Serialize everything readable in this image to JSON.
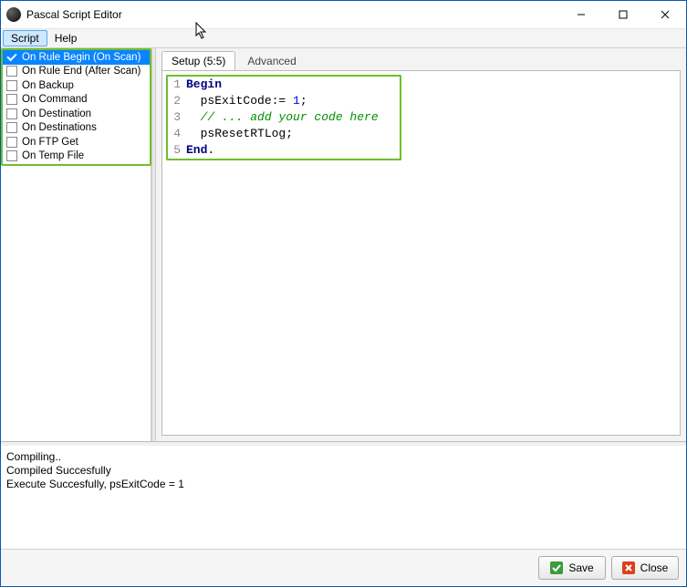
{
  "window": {
    "title": "Pascal Script Editor"
  },
  "menu": {
    "script": "Script",
    "help": "Help"
  },
  "sidebar": {
    "items": [
      {
        "label": "On Rule Begin (On Scan)",
        "checked": true,
        "selected": true
      },
      {
        "label": "On Rule End (After Scan)",
        "checked": false,
        "selected": false
      },
      {
        "label": "On Backup",
        "checked": false,
        "selected": false
      },
      {
        "label": "On Command",
        "checked": false,
        "selected": false
      },
      {
        "label": "On Destination",
        "checked": false,
        "selected": false
      },
      {
        "label": "On Destinations",
        "checked": false,
        "selected": false
      },
      {
        "label": "On FTP Get",
        "checked": false,
        "selected": false
      },
      {
        "label": "On Temp File",
        "checked": false,
        "selected": false
      }
    ]
  },
  "tabs": {
    "setup": "Setup (5:5)",
    "advanced": "Advanced"
  },
  "code": {
    "lines": [
      {
        "n": "1",
        "html": "<span class='kw'>Begin</span>"
      },
      {
        "n": "2",
        "html": "  psExitCode:= <span class='num'>1</span>;"
      },
      {
        "n": "3",
        "html": "  <span class='cm'>// ... add your code here</span>"
      },
      {
        "n": "4",
        "html": "  psResetRTLog;"
      },
      {
        "n": "5",
        "html": "<span class='kw'>End</span>."
      }
    ]
  },
  "output": {
    "lines": [
      "Compiling..",
      "Compiled Succesfully",
      "Execute Succesfully, psExitCode = 1"
    ]
  },
  "footer": {
    "save": "Save",
    "close": "Close"
  }
}
